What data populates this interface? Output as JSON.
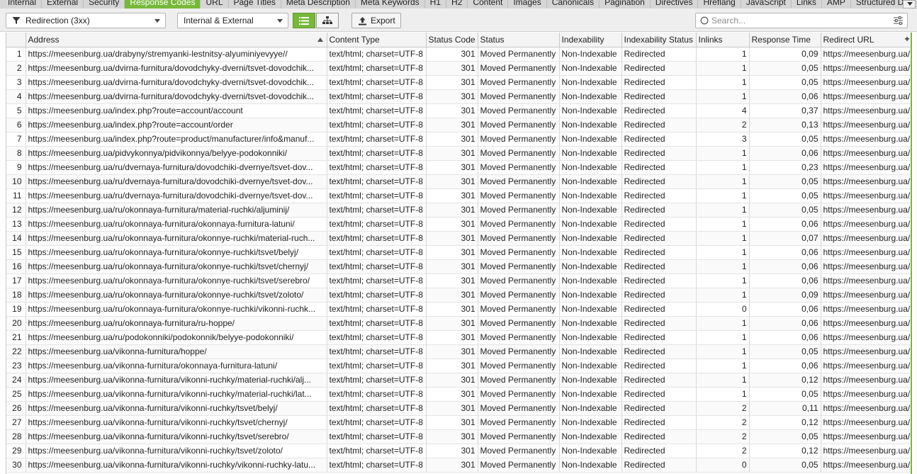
{
  "tabs": [
    "Internal",
    "External",
    "Security",
    "Response Codes",
    "URL",
    "Page Titles",
    "Meta Description",
    "Meta Keywords",
    "H1",
    "H2",
    "Content",
    "Images",
    "Canonicals",
    "Pagination",
    "Directives",
    "Hreflang",
    "JavaScript",
    "Links",
    "AMP",
    "Structured Data"
  ],
  "active_tab": "Response Codes",
  "toolbar": {
    "filter_value": "Redirection (3xx)",
    "scope_value": "Internal & External",
    "export_label": "Export",
    "search_placeholder": "Search..."
  },
  "colors": {
    "accent": "#77b83a"
  },
  "table": {
    "columns": [
      "",
      "Address",
      "Content Type",
      "Status Code",
      "Status",
      "Indexability",
      "Indexability Status",
      "Inlinks",
      "Response Time",
      "Redirect URL"
    ],
    "add_column_label": "+",
    "rows": [
      [
        "1",
        "https://meesenburg.ua/drabyny/stremyanki-lestnitsy-alyuminiyevyye//",
        "text/html; charset=UTF-8",
        "301",
        "Moved Permanently",
        "Non-Indexable",
        "Redirected",
        "1",
        "0,09",
        "https://meesenburg.ua/"
      ],
      [
        "2",
        "https://meesenburg.ua/dvirna-furnitura/dovodchyky-dverni/tsvet-dovodchik...",
        "text/html; charset=UTF-8",
        "301",
        "Moved Permanently",
        "Non-Indexable",
        "Redirected",
        "1",
        "0,05",
        "https://meesenburg.ua/"
      ],
      [
        "3",
        "https://meesenburg.ua/dvirna-furnitura/dovodchyky-dverni/tsvet-dovodchik...",
        "text/html; charset=UTF-8",
        "301",
        "Moved Permanently",
        "Non-Indexable",
        "Redirected",
        "1",
        "0,05",
        "https://meesenburg.ua/"
      ],
      [
        "4",
        "https://meesenburg.ua/dvirna-furnitura/dovodchyky-dverni/tsvet-dovodchik...",
        "text/html; charset=UTF-8",
        "301",
        "Moved Permanently",
        "Non-Indexable",
        "Redirected",
        "1",
        "0,06",
        "https://meesenburg.ua/"
      ],
      [
        "5",
        "https://meesenburg.ua/index.php?route=account/account",
        "text/html; charset=UTF-8",
        "301",
        "Moved Permanently",
        "Non-Indexable",
        "Redirected",
        "4",
        "0,37",
        "https://meesenburg.ua/"
      ],
      [
        "6",
        "https://meesenburg.ua/index.php?route=account/order",
        "text/html; charset=UTF-8",
        "301",
        "Moved Permanently",
        "Non-Indexable",
        "Redirected",
        "2",
        "0,13",
        "https://meesenburg.ua/"
      ],
      [
        "7",
        "https://meesenburg.ua/index.php?route=product/manufacturer/info&manuf...",
        "text/html; charset=UTF-8",
        "301",
        "Moved Permanently",
        "Non-Indexable",
        "Redirected",
        "3",
        "0,05",
        "https://meesenburg.ua/"
      ],
      [
        "8",
        "https://meesenburg.ua/pidvykonnya/pidvikonnya/belyye-podokonniki/",
        "text/html; charset=UTF-8",
        "301",
        "Moved Permanently",
        "Non-Indexable",
        "Redirected",
        "1",
        "0,06",
        "https://meesenburg.ua/"
      ],
      [
        "9",
        "https://meesenburg.ua/ru/dvernaya-furnitura/dovodchiki-dvernye/tsvet-dov...",
        "text/html; charset=UTF-8",
        "301",
        "Moved Permanently",
        "Non-Indexable",
        "Redirected",
        "1",
        "0,23",
        "https://meesenburg.ua/"
      ],
      [
        "10",
        "https://meesenburg.ua/ru/dvernaya-furnitura/dovodchiki-dvernye/tsvet-dov...",
        "text/html; charset=UTF-8",
        "301",
        "Moved Permanently",
        "Non-Indexable",
        "Redirected",
        "1",
        "0,05",
        "https://meesenburg.ua/"
      ],
      [
        "11",
        "https://meesenburg.ua/ru/dvernaya-furnitura/dovodchiki-dvernye/tsvet-dov...",
        "text/html; charset=UTF-8",
        "301",
        "Moved Permanently",
        "Non-Indexable",
        "Redirected",
        "1",
        "0,05",
        "https://meesenburg.ua/"
      ],
      [
        "12",
        "https://meesenburg.ua/ru/okonnaya-furnitura/material-ruchki/aljuminij/",
        "text/html; charset=UTF-8",
        "301",
        "Moved Permanently",
        "Non-Indexable",
        "Redirected",
        "1",
        "0,05",
        "https://meesenburg.ua/"
      ],
      [
        "13",
        "https://meesenburg.ua/ru/okonnaya-furnitura/okonnaya-furnitura-latuni/",
        "text/html; charset=UTF-8",
        "301",
        "Moved Permanently",
        "Non-Indexable",
        "Redirected",
        "1",
        "0,06",
        "https://meesenburg.ua/"
      ],
      [
        "14",
        "https://meesenburg.ua/ru/okonnaya-furnitura/okonnye-ruchki/material-ruch...",
        "text/html; charset=UTF-8",
        "301",
        "Moved Permanently",
        "Non-Indexable",
        "Redirected",
        "1",
        "0,07",
        "https://meesenburg.ua/"
      ],
      [
        "15",
        "https://meesenburg.ua/ru/okonnaya-furnitura/okonnye-ruchki/tsvet/belyj/",
        "text/html; charset=UTF-8",
        "301",
        "Moved Permanently",
        "Non-Indexable",
        "Redirected",
        "1",
        "0,06",
        "https://meesenburg.ua/"
      ],
      [
        "16",
        "https://meesenburg.ua/ru/okonnaya-furnitura/okonnye-ruchki/tsvet/chernyj/",
        "text/html; charset=UTF-8",
        "301",
        "Moved Permanently",
        "Non-Indexable",
        "Redirected",
        "1",
        "0,06",
        "https://meesenburg.ua/"
      ],
      [
        "17",
        "https://meesenburg.ua/ru/okonnaya-furnitura/okonnye-ruchki/tsvet/serebro/",
        "text/html; charset=UTF-8",
        "301",
        "Moved Permanently",
        "Non-Indexable",
        "Redirected",
        "1",
        "0,06",
        "https://meesenburg.ua/"
      ],
      [
        "18",
        "https://meesenburg.ua/ru/okonnaya-furnitura/okonnye-ruchki/tsvet/zoloto/",
        "text/html; charset=UTF-8",
        "301",
        "Moved Permanently",
        "Non-Indexable",
        "Redirected",
        "1",
        "0,09",
        "https://meesenburg.ua/"
      ],
      [
        "19",
        "https://meesenburg.ua/ru/okonnaya-furnitura/okonnye-ruchki/vikonni-ruchk...",
        "text/html; charset=UTF-8",
        "301",
        "Moved Permanently",
        "Non-Indexable",
        "Redirected",
        "0",
        "0,06",
        "https://meesenburg.ua/"
      ],
      [
        "20",
        "https://meesenburg.ua/ru/okonnaya-furnitura/ru-hoppe/",
        "text/html; charset=UTF-8",
        "301",
        "Moved Permanently",
        "Non-Indexable",
        "Redirected",
        "1",
        "0,06",
        "https://meesenburg.ua/"
      ],
      [
        "21",
        "https://meesenburg.ua/ru/podokonniki/podokonnik/belyye-podokonniki/",
        "text/html; charset=UTF-8",
        "301",
        "Moved Permanently",
        "Non-Indexable",
        "Redirected",
        "1",
        "0,06",
        "https://meesenburg.ua/"
      ],
      [
        "22",
        "https://meesenburg.ua/vikonna-furnitura/hoppe/",
        "text/html; charset=UTF-8",
        "301",
        "Moved Permanently",
        "Non-Indexable",
        "Redirected",
        "1",
        "0,05",
        "https://meesenburg.ua/"
      ],
      [
        "23",
        "https://meesenburg.ua/vikonna-furnitura/okonnaya-furnitura-latuni/",
        "text/html; charset=UTF-8",
        "301",
        "Moved Permanently",
        "Non-Indexable",
        "Redirected",
        "1",
        "0,06",
        "https://meesenburg.ua/"
      ],
      [
        "24",
        "https://meesenburg.ua/vikonna-furnitura/vikonni-ruchky/material-ruchki/alj...",
        "text/html; charset=UTF-8",
        "301",
        "Moved Permanently",
        "Non-Indexable",
        "Redirected",
        "1",
        "0,12",
        "https://meesenburg.ua/"
      ],
      [
        "25",
        "https://meesenburg.ua/vikonna-furnitura/vikonni-ruchky/material-ruchki/lat...",
        "text/html; charset=UTF-8",
        "301",
        "Moved Permanently",
        "Non-Indexable",
        "Redirected",
        "1",
        "0,05",
        "https://meesenburg.ua/"
      ],
      [
        "26",
        "https://meesenburg.ua/vikonna-furnitura/vikonni-ruchky/tsvet/belyj/",
        "text/html; charset=UTF-8",
        "301",
        "Moved Permanently",
        "Non-Indexable",
        "Redirected",
        "2",
        "0,11",
        "https://meesenburg.ua/"
      ],
      [
        "27",
        "https://meesenburg.ua/vikonna-furnitura/vikonni-ruchky/tsvet/chernyj/",
        "text/html; charset=UTF-8",
        "301",
        "Moved Permanently",
        "Non-Indexable",
        "Redirected",
        "2",
        "0,12",
        "https://meesenburg.ua/"
      ],
      [
        "28",
        "https://meesenburg.ua/vikonna-furnitura/vikonni-ruchky/tsvet/serebro/",
        "text/html; charset=UTF-8",
        "301",
        "Moved Permanently",
        "Non-Indexable",
        "Redirected",
        "2",
        "0,05",
        "https://meesenburg.ua/"
      ],
      [
        "29",
        "https://meesenburg.ua/vikonna-furnitura/vikonni-ruchky/tsvet/zoloto/",
        "text/html; charset=UTF-8",
        "301",
        "Moved Permanently",
        "Non-Indexable",
        "Redirected",
        "2",
        "0,12",
        "https://meesenburg.ua/"
      ],
      [
        "30",
        "https://meesenburg.ua/vikonna-furnitura/vikonni-ruchky/vikonni-ruchky-latu...",
        "text/html; charset=UTF-8",
        "301",
        "Moved Permanently",
        "Non-Indexable",
        "Redirected",
        "0",
        "0,05",
        "https://meesenburg.ua/"
      ]
    ]
  }
}
